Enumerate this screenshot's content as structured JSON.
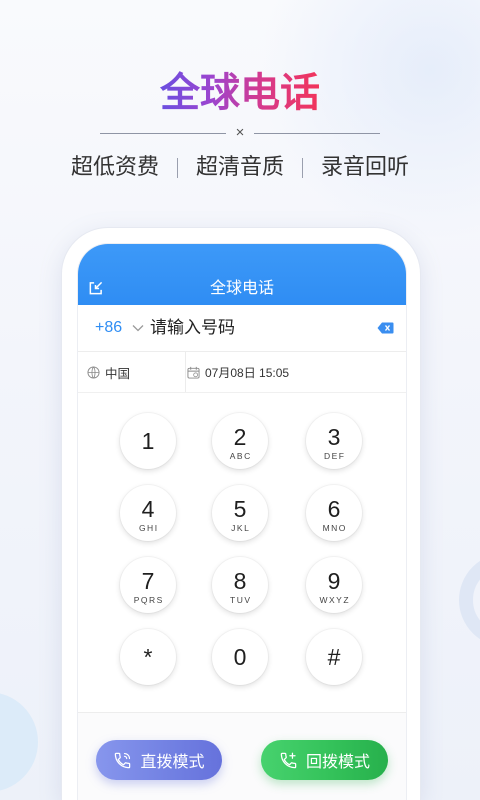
{
  "hero": {
    "title": "全球电话",
    "divider_mark": "×",
    "features": [
      "超低资费",
      "超清音质",
      "录音回听"
    ]
  },
  "app": {
    "header_title": "全球电话",
    "header_icon": "minimize-icon",
    "country_code": "+86",
    "phone_placeholder": "请输入号码",
    "backspace_icon": "backspace-icon",
    "country_icon": "globe-icon",
    "country_name": "中国",
    "datetime_icon": "calendar-icon",
    "datetime": "07月08日 15:05"
  },
  "keypad": [
    {
      "digit": "1",
      "letters": ""
    },
    {
      "digit": "2",
      "letters": "ABC"
    },
    {
      "digit": "3",
      "letters": "DEF"
    },
    {
      "digit": "4",
      "letters": "GHI"
    },
    {
      "digit": "5",
      "letters": "JKL"
    },
    {
      "digit": "6",
      "letters": "MNO"
    },
    {
      "digit": "7",
      "letters": "PQRS"
    },
    {
      "digit": "8",
      "letters": "TUV"
    },
    {
      "digit": "9",
      "letters": "WXYZ"
    },
    {
      "digit": "*",
      "letters": ""
    },
    {
      "digit": "0",
      "letters": ""
    },
    {
      "digit": "#",
      "letters": ""
    }
  ],
  "actions": {
    "direct": {
      "label": "直拨模式",
      "icon": "phone-icon"
    },
    "callback": {
      "label": "回拨模式",
      "icon": "phone-callback-icon"
    }
  },
  "colors": {
    "title_gradient_start": "#6a4fe0",
    "title_gradient_end": "#f2345a",
    "accent_blue": "#2f8df3",
    "direct_button": "#7382e3",
    "callback_button": "#34c25a"
  }
}
